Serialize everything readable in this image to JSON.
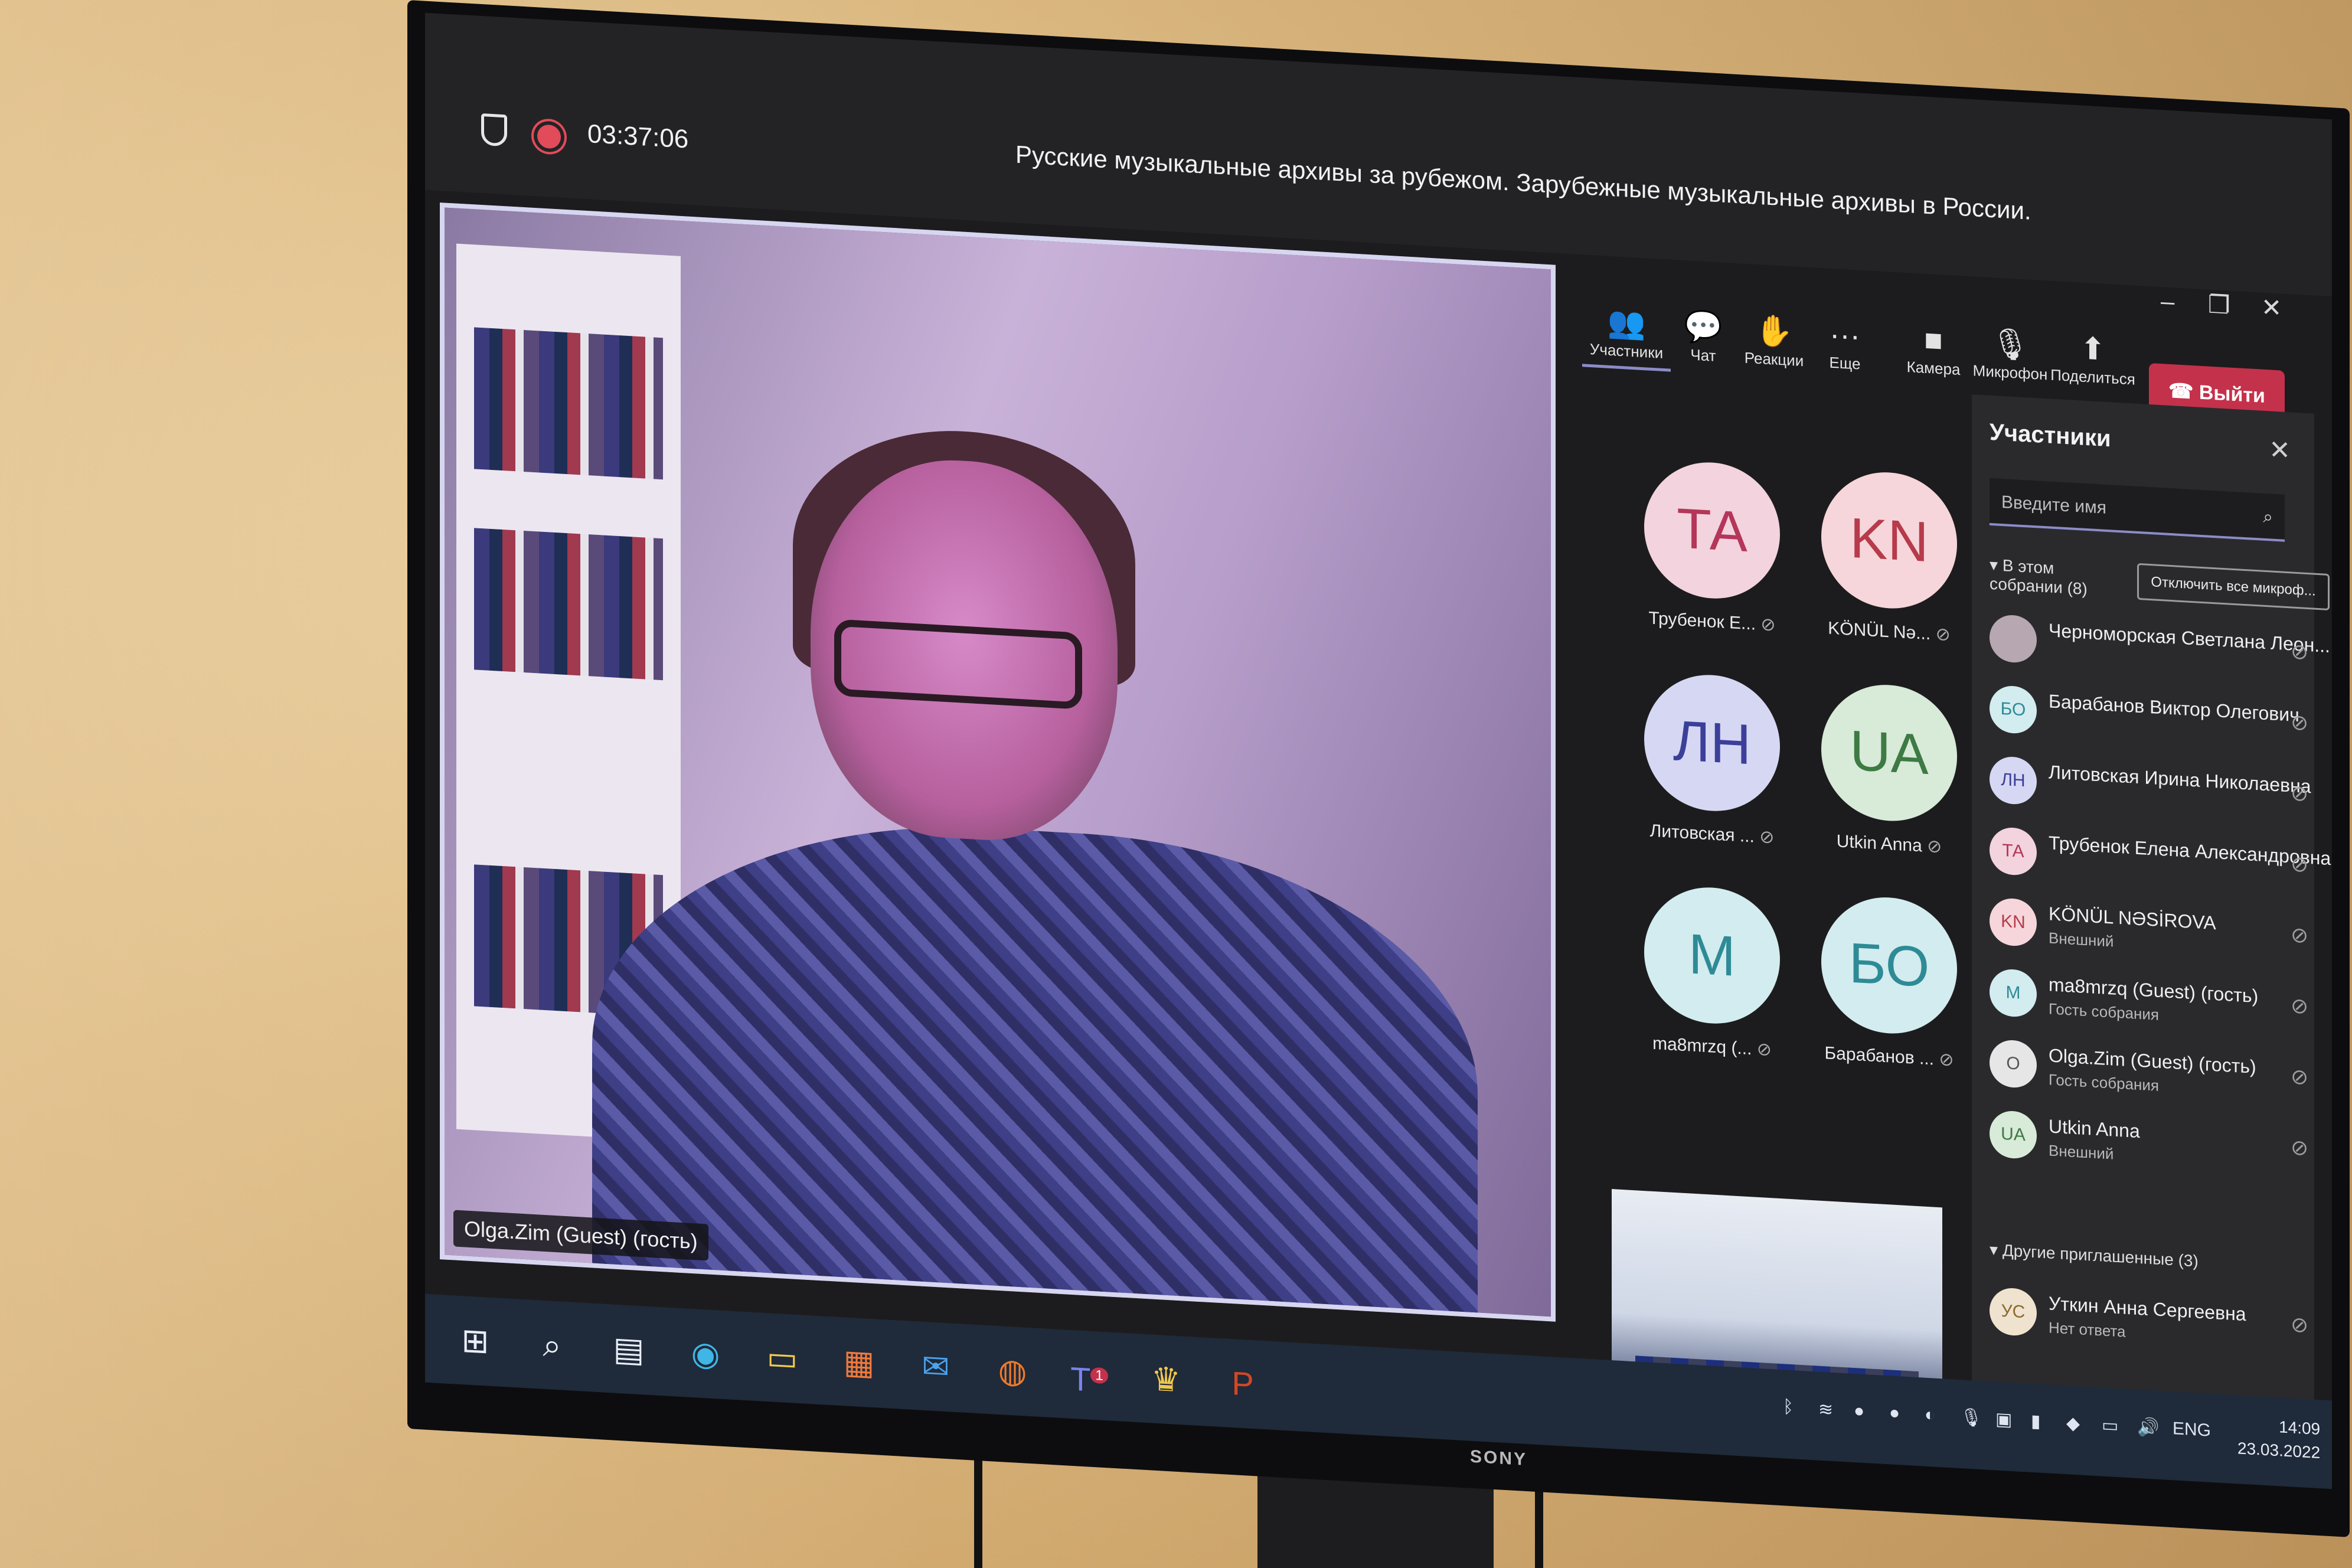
{
  "meeting": {
    "timer": "03:37:06",
    "title": "Русские музыкальные архивы за рубежом. Зарубежные музыкальные архивы в России."
  },
  "toolbar": {
    "participants": "Участники",
    "chat": "Чат",
    "reactions": "Реакции",
    "more": "Еще",
    "camera": "Камера",
    "mic": "Микрофон",
    "share": "Поделиться",
    "leave": "Выйти"
  },
  "window_controls": {
    "minimize": "–",
    "maximize": "❐",
    "close": "✕"
  },
  "main_video": {
    "label": "Olga.Zim (Guest) (гость)"
  },
  "grid": [
    {
      "initials": "ТА",
      "name": "Трубенок Е...",
      "bg": "#f3d3dd",
      "fg": "#b4365a"
    },
    {
      "initials": "KN",
      "name": "KÖNÜL Nə...",
      "bg": "#f6d6da",
      "fg": "#b63b4b"
    },
    {
      "initials": "ЛН",
      "name": "Литовская ...",
      "bg": "#d6d8f3",
      "fg": "#3c3f9a"
    },
    {
      "initials": "UA",
      "name": "Utkin Anna",
      "bg": "#d8ead8",
      "fg": "#3d7a44"
    },
    {
      "initials": "M",
      "name": "ma8mrzq (...",
      "bg": "#d3ecef",
      "fg": "#2e8b96"
    },
    {
      "initials": "БО",
      "name": "Барабанов ...",
      "bg": "#d3ecef",
      "fg": "#2e8b96"
    }
  ],
  "panel": {
    "title": "Участники",
    "close": "✕",
    "search_placeholder": "Введите имя",
    "in_meeting": "В этом собрании (8)",
    "mute_all": "Отключить все микроф...",
    "others": "Другие приглашенные (3)",
    "people": [
      {
        "initials": "",
        "name": "Черноморская Светлана Леон...",
        "sub": "",
        "bg": "#b6a7b0",
        "fg": "#ffffff"
      },
      {
        "initials": "БО",
        "name": "Барабанов Виктор Олегович",
        "sub": "",
        "bg": "#d3ecef",
        "fg": "#2e8b96"
      },
      {
        "initials": "ЛН",
        "name": "Литовская Ирина Николаевна",
        "sub": "",
        "bg": "#d6d8f3",
        "fg": "#3c3f9a"
      },
      {
        "initials": "ТА",
        "name": "Трубенок Елена Александровна",
        "sub": "",
        "bg": "#f3d3dd",
        "fg": "#b4365a"
      },
      {
        "initials": "KN",
        "name": "KÖNÜL NƏSİROVA",
        "sub": "Внешний",
        "bg": "#f6d6da",
        "fg": "#b63b4b"
      },
      {
        "initials": "M",
        "name": "ma8mrzq (Guest) (гость)",
        "sub": "Гость собрания",
        "bg": "#d3ecef",
        "fg": "#2e8b96"
      },
      {
        "initials": "O",
        "name": "Olga.Zim (Guest) (гость)",
        "sub": "Гость собрания",
        "bg": "#e6e6e6",
        "fg": "#555555"
      },
      {
        "initials": "UA",
        "name": "Utkin Anna",
        "sub": "Внешний",
        "bg": "#d8ead8",
        "fg": "#3d7a44"
      }
    ],
    "invited": [
      {
        "initials": "УС",
        "name": "Уткин Анна Сергеевна",
        "sub": "Нет ответа",
        "bg": "#efe3cf",
        "fg": "#8a6a2e"
      }
    ]
  },
  "taskbar": {
    "teams_badge": "1",
    "lang": "ENG",
    "time": "14:09",
    "date": "23.03.2022"
  },
  "brand": "SONY"
}
